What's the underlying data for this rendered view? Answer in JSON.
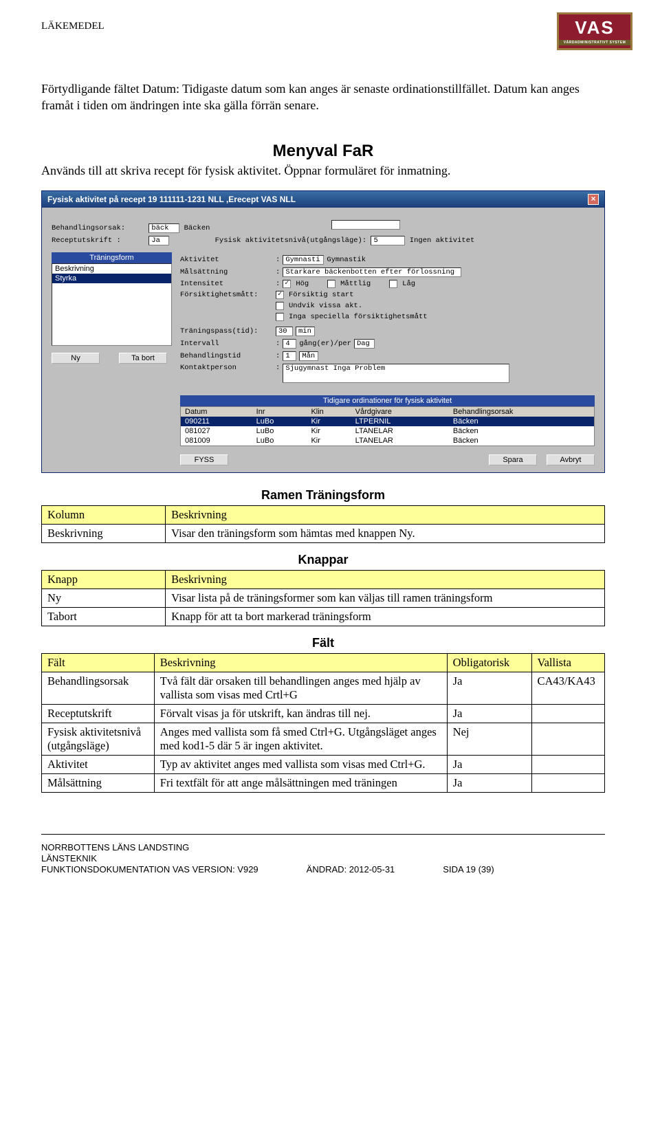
{
  "header": {
    "topLabel": "LÄKEMEDEL"
  },
  "logo": {
    "main": "VAS",
    "sub": "VÅRDADMINISTRATIVT SYSTEM"
  },
  "intro": {
    "p1": "Förtydligande fältet Datum: Tidigaste datum som kan anges är senaste ordinationstillfället. Datum kan anges framåt i tiden om ändringen inte ska gälla förrän senare."
  },
  "section": {
    "title": "Menyval FaR",
    "sub": "Används till att skriva recept för fysisk aktivitet. Öppnar formuläret för inmatning."
  },
  "win": {
    "title": "Fysisk aktivitet på recept  19 111111-1231  NLL ,Erecept VAS NLL",
    "top": {
      "behandlingsorsak_label": "Behandlingsorsak:",
      "behandlingsorsak_value": "bäck",
      "behandlingsorsak_text": "Bäcken",
      "receptutskrift_label": "Receptutskrift  :",
      "receptutskrift_value": "Ja",
      "fysniva_label": "Fysisk aktivitetsnivå(utgångsläge):",
      "fysniva_value": "5",
      "fysniva_text": "Ingen aktivitet"
    },
    "tlist": {
      "title": "Träningsform",
      "items": [
        "Beskrivning",
        "Styrka"
      ],
      "selected": 1,
      "btnNy": "Ny",
      "btnTaBort": "Ta bort"
    },
    "right": {
      "aktivitet_label": "Aktivitet",
      "aktivitet_value": "Gymnasti",
      "aktivitet_text": "Gymnastik",
      "mal_label": "Målsättning",
      "mal_value": "Starkare bäckenbotten efter förlossning",
      "intens_label": "Intensitet",
      "intens_hog": "Hög",
      "intens_matt": "Måttlig",
      "intens_lag": "Låg",
      "fors_label": "Försiktighetsmått:",
      "fors_1": "Försiktig start",
      "fors_2": "Undvik vissa akt.",
      "fors_3": "Inga speciella försiktighetsmått",
      "tpass_label": "Träningspass(tid):",
      "tpass_value": "30",
      "tpass_unit": "min",
      "intervall_label": "Intervall",
      "intervall_value": "4",
      "intervall_mid": "gång(er)/per",
      "intervall_unit": "Dag",
      "btid_label": "Behandlingstid",
      "btid_value": "1",
      "btid_unit": "Mån",
      "kontakt_label": "Kontaktperson",
      "kontakt_value": "Sjugymnast Inga Problem"
    },
    "ord": {
      "title": "Tidigare ordinationer för fysisk aktivitet",
      "cols": [
        "Datum",
        "Inr",
        "Klin",
        "Vårdgivare",
        "Behandlingsorsak"
      ],
      "rows": [
        {
          "cells": [
            "090211",
            "LuBo",
            "Kir",
            "LTPERNIL",
            "Bäcken"
          ],
          "sel": true
        },
        {
          "cells": [
            "081027",
            "LuBo",
            "Kir",
            "LTANELAR",
            "Bäcken"
          ],
          "sel": false
        },
        {
          "cells": [
            "081009",
            "LuBo",
            "Kir",
            "LTANELAR",
            "Bäcken"
          ],
          "sel": false
        }
      ]
    },
    "btns": {
      "fyss": "FYSS",
      "spara": "Spara",
      "avbryt": "Avbryt"
    }
  },
  "table1": {
    "title": "Ramen Träningsform",
    "head": [
      "Kolumn",
      "Beskrivning"
    ],
    "rows": [
      [
        "Beskrivning",
        "Visar den träningsform som hämtas med knappen Ny."
      ]
    ]
  },
  "table2": {
    "title": "Knappar",
    "head": [
      "Knapp",
      "Beskrivning"
    ],
    "rows": [
      [
        "Ny",
        "Visar lista på de träningsformer som kan väljas till ramen träningsform"
      ],
      [
        "Tabort",
        "Knapp för att ta bort markerad träningsform"
      ]
    ]
  },
  "table3": {
    "title": "Fält",
    "head": [
      "Fält",
      "Beskrivning",
      "Obligatorisk",
      "Vallista"
    ],
    "rows": [
      [
        "Behandlingsorsak",
        "Två fält där orsaken till behandlingen anges med hjälp av vallista som visas med Crtl+G",
        "Ja",
        "CA43/KA43"
      ],
      [
        "Receptutskrift",
        "Förvalt visas ja för utskrift, kan ändras till nej.",
        "Ja",
        ""
      ],
      [
        "Fysisk aktivitetsnivå (utgångsläge)",
        "Anges med vallista som få smed Ctrl+G. Utgångsläget anges med kod1-5 där 5 är ingen aktivitet.",
        "Nej",
        ""
      ],
      [
        "Aktivitet",
        "Typ av aktivitet anges med vallista som visas med Ctrl+G.",
        "Ja",
        ""
      ],
      [
        "Målsättning",
        "Fri textfält för att ange målsättningen med träningen",
        "Ja",
        ""
      ]
    ]
  },
  "footer": {
    "l1": "NORRBOTTENS LÄNS LANDSTING",
    "l2": "LÄNSTEKNIK",
    "l3": "FUNKTIONSDOKUMENTATION VAS VERSION: V929",
    "mid": "ÄNDRAD: 2012-05-31",
    "right": "SIDA 19 (39)"
  }
}
